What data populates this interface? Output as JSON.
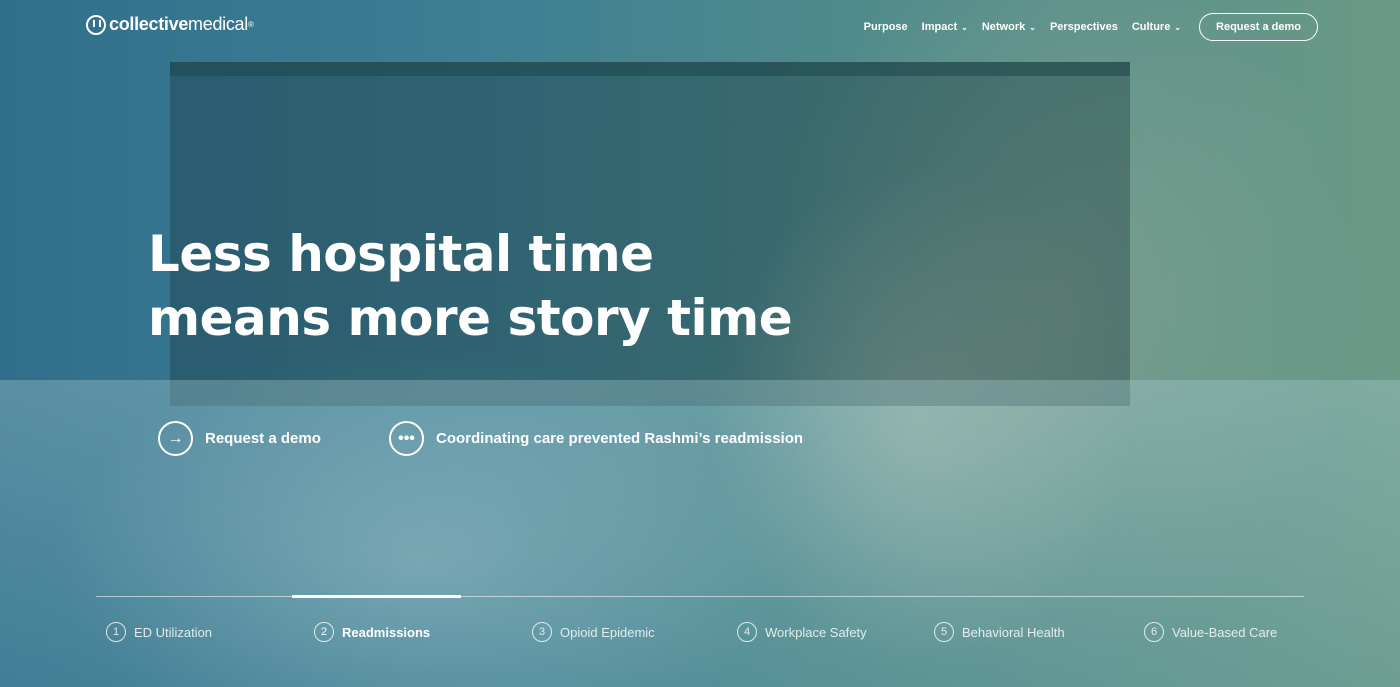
{
  "brand": {
    "logo_part1": "collective",
    "logo_part2": "medical",
    "mark": "®"
  },
  "nav": {
    "items": [
      {
        "label": "Purpose",
        "dropdown": false
      },
      {
        "label": "Impact",
        "dropdown": true
      },
      {
        "label": "Network",
        "dropdown": true
      },
      {
        "label": "Perspectives",
        "dropdown": false
      },
      {
        "label": "Culture",
        "dropdown": true
      }
    ],
    "cta": "Request a demo"
  },
  "hero": {
    "headline_line1": "Less hospital time",
    "headline_line2": "means more story time",
    "cta_primary": {
      "label": "Request a demo",
      "icon": "arrow-right-icon"
    },
    "cta_secondary": {
      "label": "Coordinating care prevented Rashmi’s readmission",
      "icon": "more-dots-icon"
    }
  },
  "tabs": {
    "active_index": 1,
    "items": [
      {
        "num": "1",
        "label": "ED Utilization"
      },
      {
        "num": "2",
        "label": "Readmissions"
      },
      {
        "num": "3",
        "label": "Opioid Epidemic"
      },
      {
        "num": "4",
        "label": "Workplace Safety"
      },
      {
        "num": "5",
        "label": "Behavioral Health"
      },
      {
        "num": "6",
        "label": "Value-Based Care"
      }
    ]
  },
  "colors": {
    "overlay": "#3f7f93",
    "text": "#ffffff"
  }
}
